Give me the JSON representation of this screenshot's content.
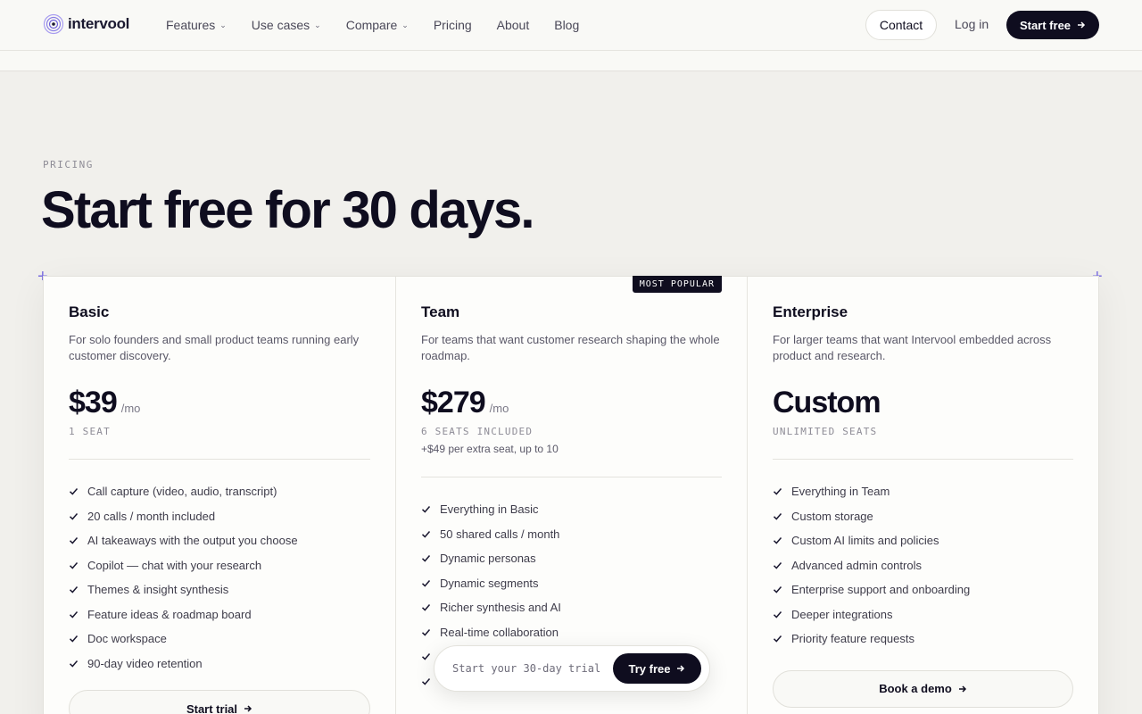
{
  "brand": {
    "name": "intervool",
    "accent": "#7b6ee0",
    "dark": "#0f0d1f"
  },
  "nav": {
    "items": [
      {
        "label": "Features",
        "dropdown": true
      },
      {
        "label": "Use cases",
        "dropdown": true
      },
      {
        "label": "Compare",
        "dropdown": true
      },
      {
        "label": "Pricing",
        "dropdown": false
      },
      {
        "label": "About",
        "dropdown": false
      },
      {
        "label": "Blog",
        "dropdown": false
      }
    ],
    "contact_label": "Contact",
    "login_label": "Log in",
    "start_label": "Start free"
  },
  "hero": {
    "eyebrow": "PRICING",
    "title": "Start free for 30 days."
  },
  "plans": [
    {
      "name": "Basic",
      "description": "For solo founders and small product teams running early customer discovery.",
      "price": "$39",
      "period": "/mo",
      "seats": "1 SEAT",
      "features": [
        "Call capture (video, audio, transcript)",
        "20 calls / month included",
        "AI takeaways with the output you choose",
        "Copilot — chat with your research",
        "Themes & insight synthesis",
        "Feature ideas & roadmap board",
        "Doc workspace",
        "90-day video retention"
      ],
      "cta": "Start trial"
    },
    {
      "name": "Team",
      "badge": "MOST POPULAR",
      "description": "For teams that want customer research shaping the whole roadmap.",
      "price": "$279",
      "period": "/mo",
      "seats": "6 SEATS INCLUDED",
      "extra": "+$49 per extra seat, up to 10",
      "features": [
        "Everything in Basic",
        "50 shared calls / month",
        "Dynamic personas",
        "Dynamic segments",
        "Richer synthesis and AI",
        "Real-time collaboration",
        "",
        ""
      ]
    },
    {
      "name": "Enterprise",
      "description": "For larger teams that want Intervool embedded across product and research.",
      "price": "Custom",
      "seats": "UNLIMITED SEATS",
      "features": [
        "Everything in Team",
        "Custom storage",
        "Custom AI limits and policies",
        "Advanced admin controls",
        "Enterprise support and onboarding",
        "Deeper integrations",
        "Priority feature requests"
      ],
      "cta": "Book a demo"
    }
  ],
  "floating_cta": {
    "hint": "Start your 30-day trial",
    "button": "Try free"
  }
}
